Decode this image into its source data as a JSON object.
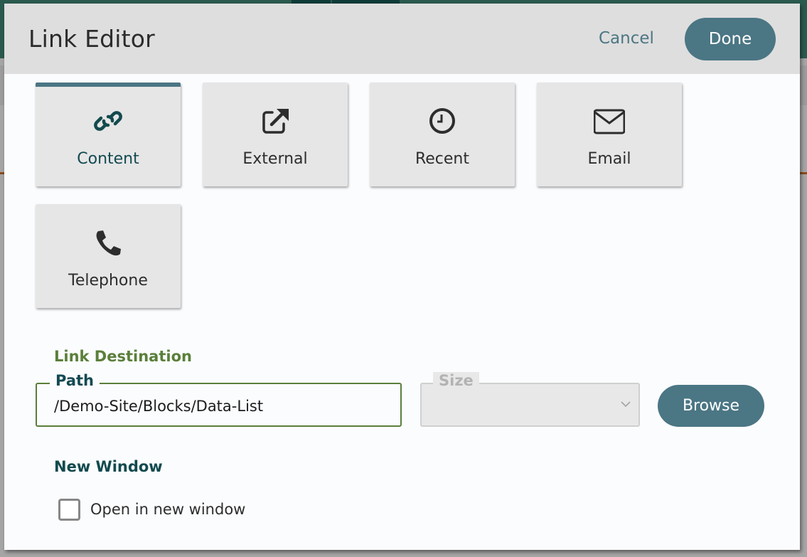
{
  "dialog": {
    "title": "Link Editor",
    "cancel_label": "Cancel",
    "done_label": "Done"
  },
  "link_types": [
    {
      "label": "Content",
      "icon": "link-icon",
      "active": true
    },
    {
      "label": "External",
      "icon": "external-link-icon",
      "active": false
    },
    {
      "label": "Recent",
      "icon": "clock-icon",
      "active": false
    },
    {
      "label": "Email",
      "icon": "envelope-icon",
      "active": false
    },
    {
      "label": "Telephone",
      "icon": "phone-icon",
      "active": false
    }
  ],
  "link_destination": {
    "section_title": "Link Destination",
    "path_label": "Path",
    "path_value": "/Demo-Site/Blocks/Data-List",
    "size_label": "Size",
    "size_value": "",
    "browse_label": "Browse"
  },
  "new_window": {
    "section_title": "New Window",
    "checkbox_label": "Open in new window",
    "checked": false
  },
  "colors": {
    "accent": "#4b7684",
    "section_green": "#5a7f3a",
    "section_teal": "#124a4e",
    "header_bg": "#dedede",
    "tile_bg": "#e6e6e6"
  }
}
